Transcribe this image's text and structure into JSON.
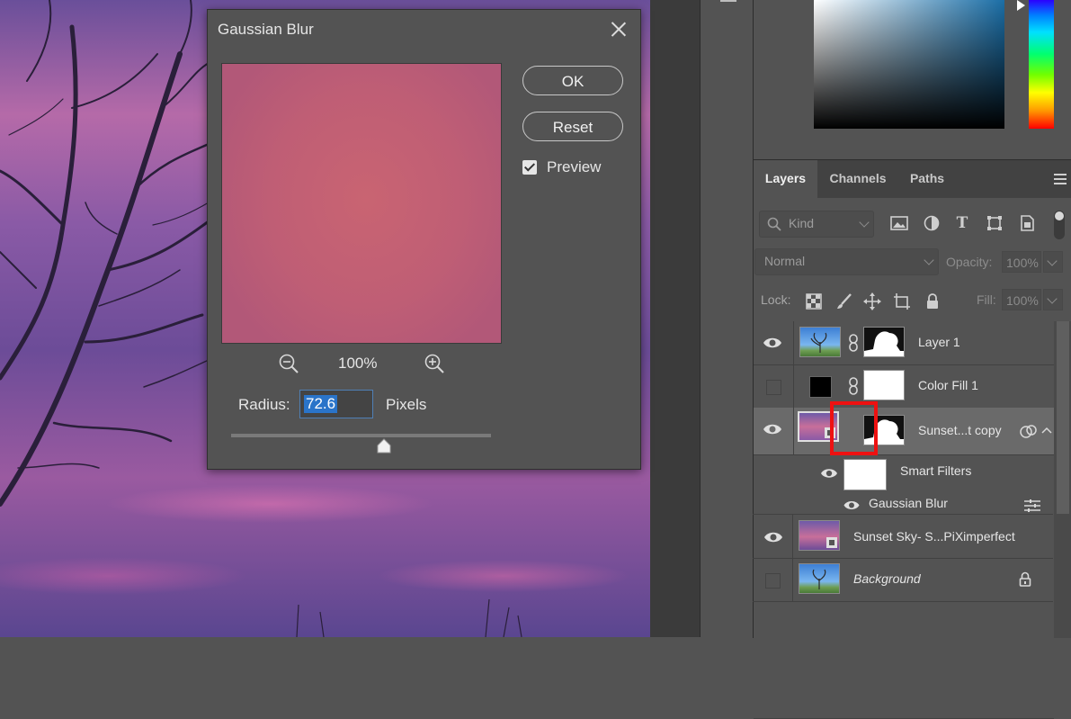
{
  "dialog": {
    "title": "Gaussian Blur",
    "ok_label": "OK",
    "reset_label": "Reset",
    "preview_label": "Preview",
    "preview_checked": true,
    "zoom_level": "100%",
    "radius_label": "Radius:",
    "radius_value": "72.6",
    "radius_unit": "Pixels"
  },
  "layers_panel": {
    "tabs": [
      {
        "label": "Layers",
        "active": true
      },
      {
        "label": "Channels",
        "active": false
      },
      {
        "label": "Paths",
        "active": false
      }
    ],
    "kind_filter": "Kind",
    "blend_mode": "Normal",
    "opacity_label": "Opacity:",
    "opacity_value": "100%",
    "lock_label": "Lock:",
    "fill_label": "Fill:",
    "fill_value": "100%",
    "layers": [
      {
        "name": "Layer 1",
        "visible": true
      },
      {
        "name": "Color Fill 1",
        "visible": false
      },
      {
        "name": "Sunset...t copy",
        "visible": true,
        "selected": true
      },
      {
        "name": "Smart Filters",
        "visible": true
      },
      {
        "name": "Gaussian Blur",
        "visible": true
      },
      {
        "name": "Sunset Sky- S...PiXimperfect",
        "visible": true
      },
      {
        "name": "Background",
        "visible": false,
        "locked": true
      }
    ]
  },
  "colors": {
    "selection_highlight": "#ee1111",
    "text_selection": "#2a74c9"
  }
}
